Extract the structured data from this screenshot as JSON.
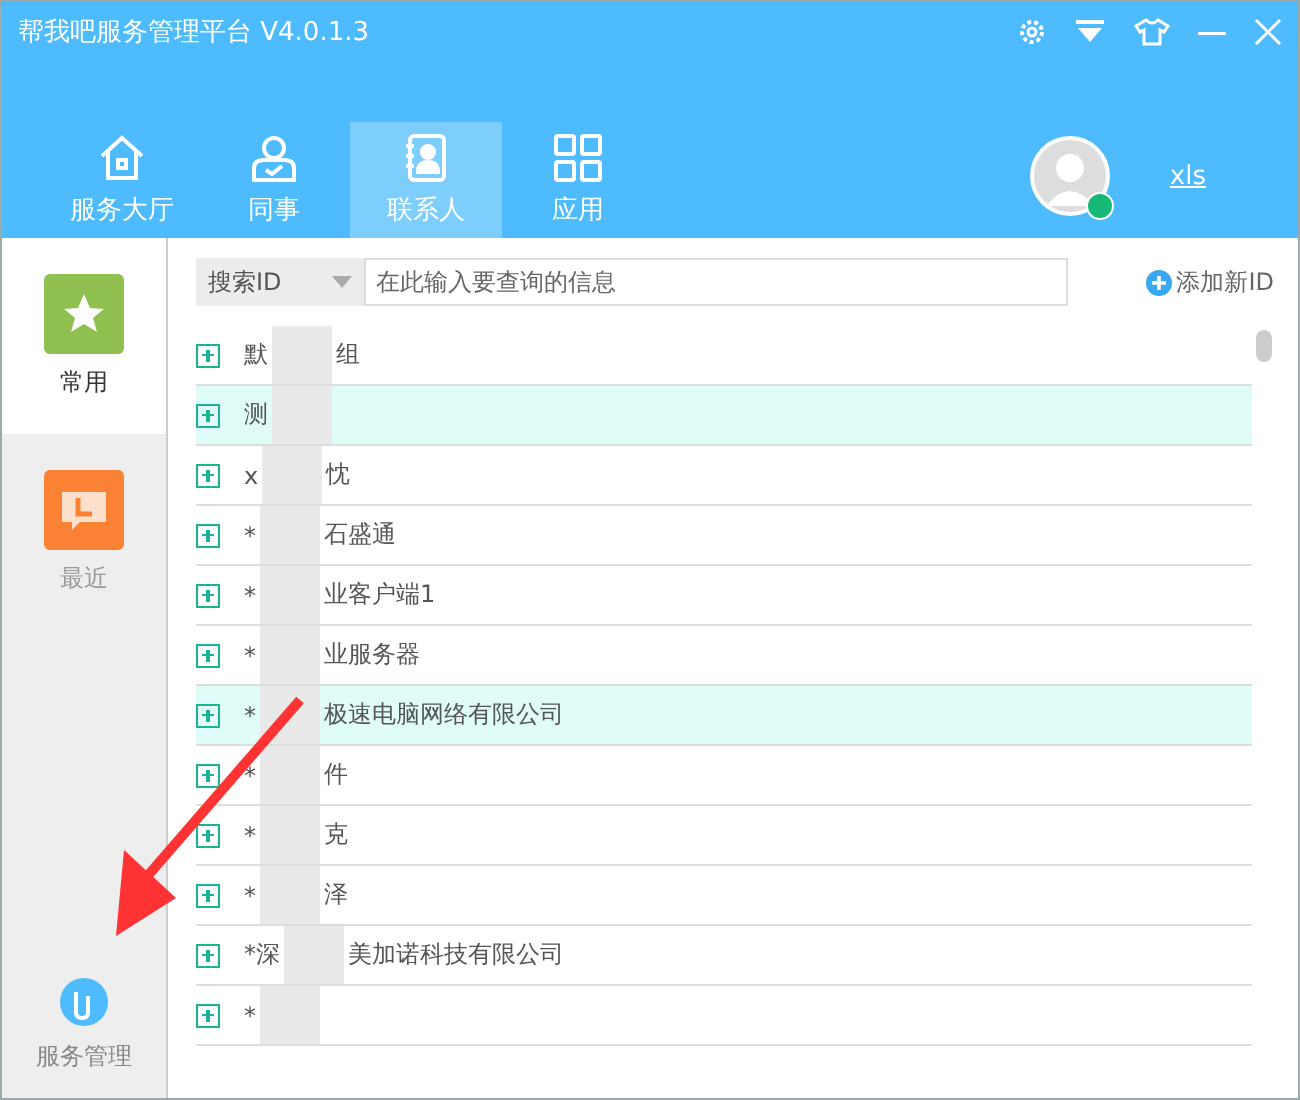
{
  "window": {
    "title": "帮我吧服务管理平台 V4.0.1.3"
  },
  "nav_tabs": [
    {
      "label": "服务大厅",
      "selected": false
    },
    {
      "label": "同事",
      "selected": false
    },
    {
      "label": "联系人",
      "selected": true
    },
    {
      "label": "应用",
      "selected": false
    }
  ],
  "user": {
    "name": "xls",
    "online": true
  },
  "sidebar": {
    "items": [
      {
        "label": "常用",
        "selected": true
      },
      {
        "label": "最近",
        "selected": false
      }
    ],
    "bottom": {
      "label": "服务管理"
    }
  },
  "search": {
    "type": "搜索ID",
    "placeholder": "在此输入要查询的信息",
    "add_button": "添加新ID"
  },
  "list": [
    {
      "prefix": "默",
      "suffix": "组",
      "selected": false
    },
    {
      "prefix": "测",
      "selected": true
    },
    {
      "prefix": "x",
      "suffix": "忱",
      "selected": false
    },
    {
      "prefix": "*",
      "suffix": "石盛通",
      "selected": false
    },
    {
      "prefix": "*",
      "suffix": "业客户端1",
      "selected": false
    },
    {
      "prefix": "*",
      "suffix": "业服务器",
      "selected": false
    },
    {
      "prefix": "*",
      "suffix": "极速电脑网络有限公司",
      "selected": true
    },
    {
      "prefix": "*",
      "suffix": "件",
      "selected": false
    },
    {
      "prefix": "*",
      "suffix": "克",
      "selected": false
    },
    {
      "prefix": "*",
      "suffix": "泽",
      "selected": false
    },
    {
      "prefix": "*深",
      "suffix": "美加诺科技有限公司",
      "selected": false
    },
    {
      "prefix": "*",
      "selected": false
    }
  ]
}
